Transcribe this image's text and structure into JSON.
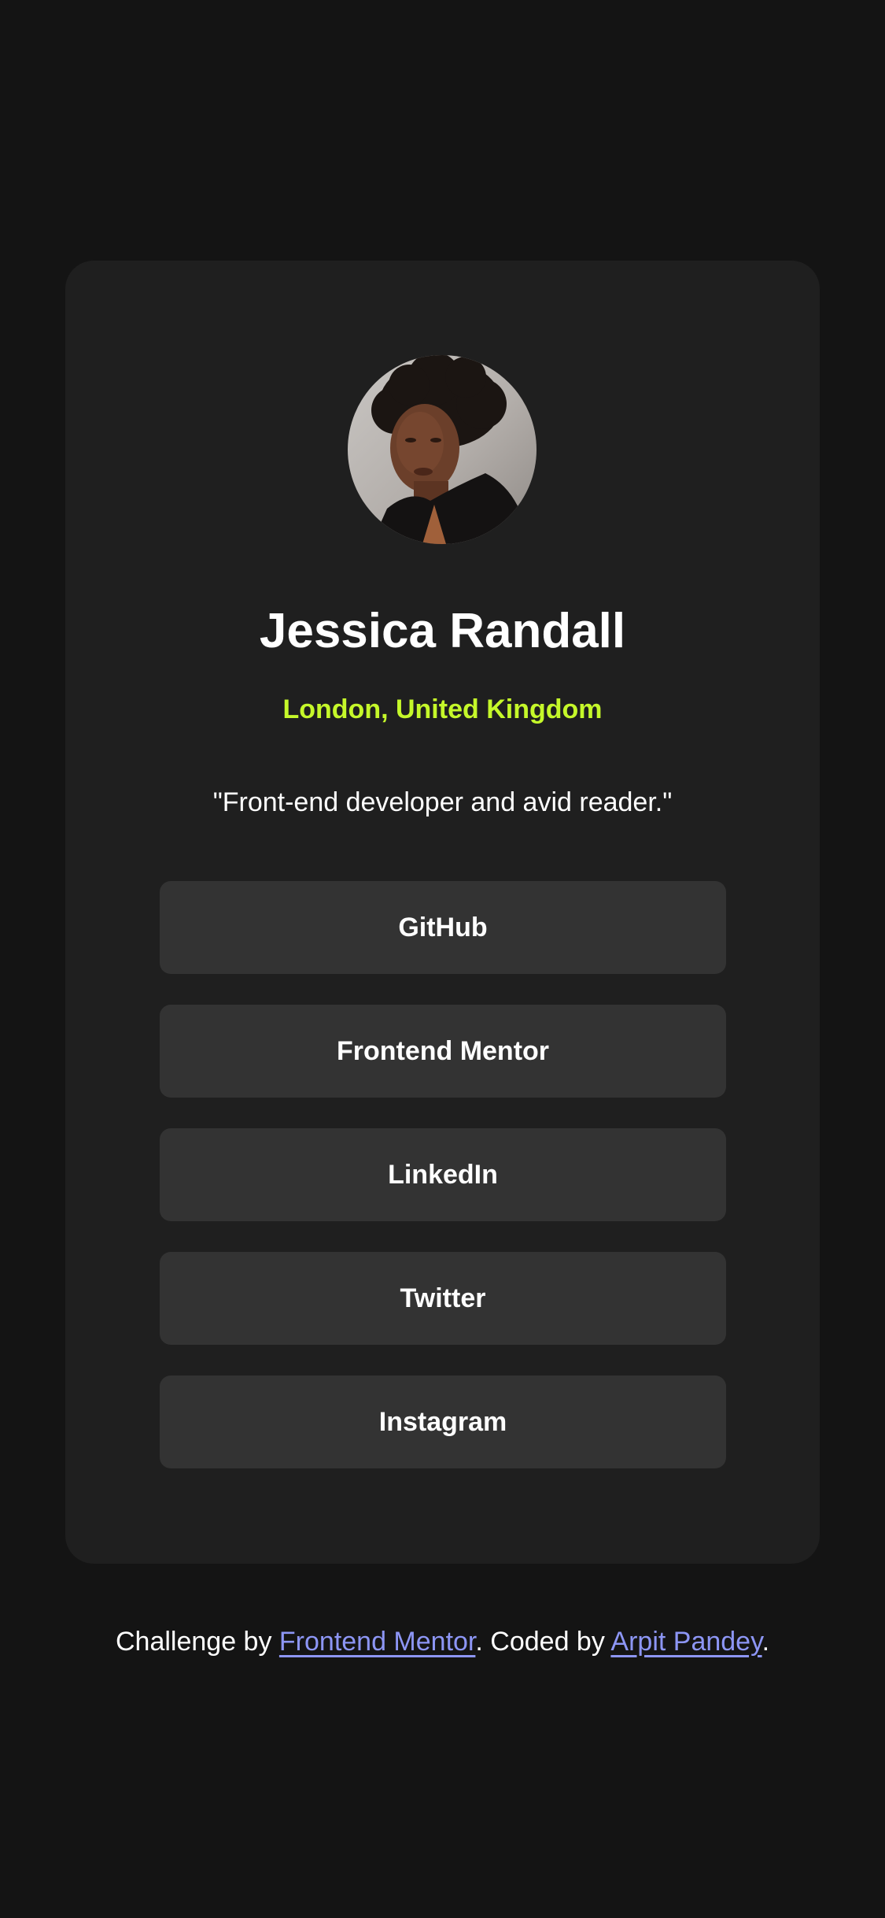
{
  "profile": {
    "name": "Jessica Randall",
    "location": "London, United Kingdom",
    "bio": "\"Front-end developer and avid reader.\"",
    "avatar_icon": "profile-photo"
  },
  "links": [
    {
      "label": "GitHub"
    },
    {
      "label": "Frontend Mentor"
    },
    {
      "label": "LinkedIn"
    },
    {
      "label": "Twitter"
    },
    {
      "label": "Instagram"
    }
  ],
  "footer": {
    "prefix": "Challenge by ",
    "challenge_link": "Frontend Mentor",
    "middle": ". Coded by ",
    "author_link": "Arpit Pandey",
    "suffix": "."
  },
  "colors": {
    "background": "#141414",
    "card": "#1f1f1f",
    "button": "#333333",
    "accent": "#c5f82a",
    "link": "#8d96f5"
  }
}
